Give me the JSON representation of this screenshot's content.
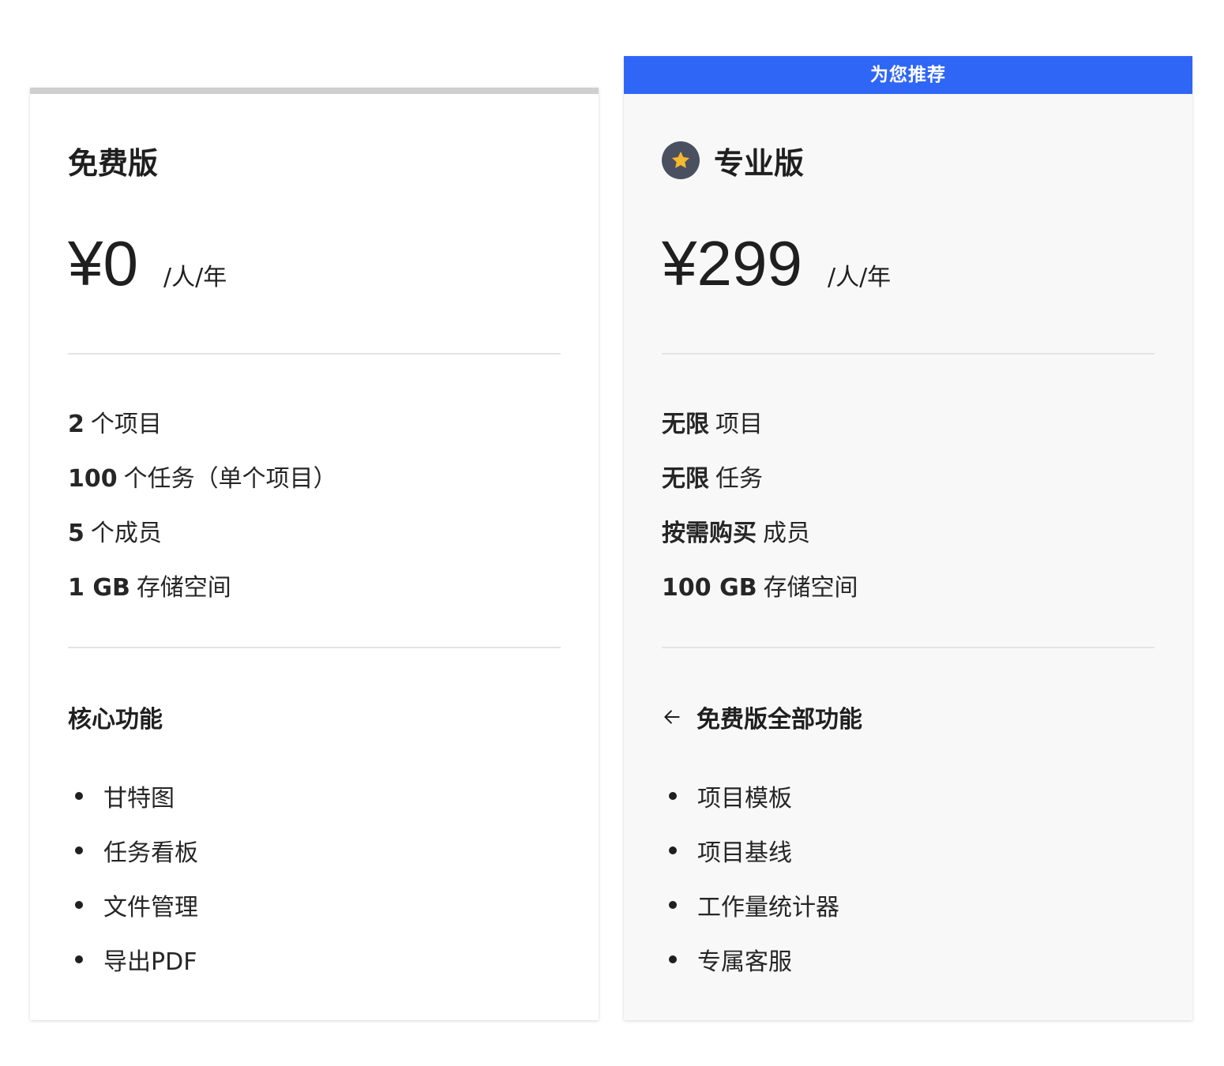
{
  "free_plan": {
    "title": "免费版",
    "price": "¥0",
    "per": "/人/年",
    "limits": [
      {
        "value": "2",
        "label": "个项目"
      },
      {
        "value": "100",
        "label": "个任务（单个项目）"
      },
      {
        "value": "5",
        "label": "个成员"
      },
      {
        "value": "1 GB",
        "label": "存储空间"
      }
    ],
    "section_title": "核心功能",
    "features": [
      "甘特图",
      "任务看板",
      "文件管理",
      "导出PDF"
    ],
    "top_bar_color": "#cfcfcf"
  },
  "pro_plan": {
    "ribbon": "为您推荐",
    "ribbon_color": "#2f66f6",
    "badge_icon": "star-icon",
    "badge_color": "#4a5060",
    "star_color": "#f5b82e",
    "title": "专业版",
    "price": "¥299",
    "per": "/人/年",
    "limits": [
      {
        "value": "无限",
        "label": "项目"
      },
      {
        "value": "无限",
        "label": "任务"
      },
      {
        "value": "按需购买",
        "label": "成员"
      },
      {
        "value": "100 GB",
        "label": "存储空间"
      }
    ],
    "section_icon": "arrow-left-icon",
    "section_title": "免费版全部功能",
    "features": [
      "项目模板",
      "项目基线",
      "工作量统计器",
      "专属客服"
    ]
  }
}
